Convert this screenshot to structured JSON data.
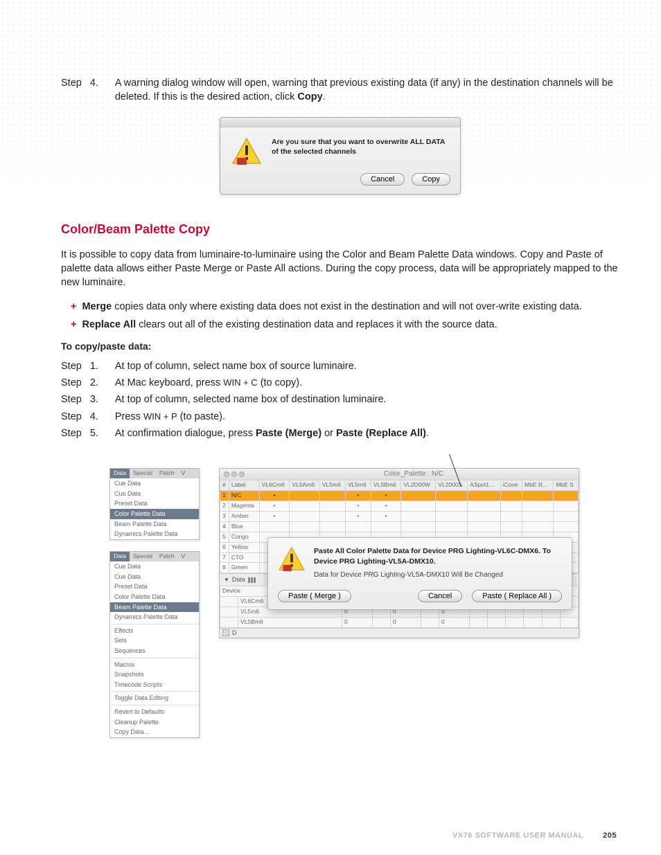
{
  "step4": {
    "label": "Step",
    "num": "4.",
    "text_a": "A warning dialog window will open, warning that previous existing data (if any) in the destination channels will be deleted. If this is the desired action, click ",
    "text_b": "Copy",
    "text_c": "."
  },
  "dialog1": {
    "message": "Are you sure that you want to overwrite ALL DATA of the selected channels",
    "cancel": "Cancel",
    "copy": "Copy"
  },
  "section_title": "Color/Beam Palette Copy",
  "intro": "It is possible to copy data from luminaire-to-luminaire using the Color and Beam Palette Data windows. Copy and Paste of palette data allows either Paste Merge or Paste All actions. During the copy process, data will be appropriately mapped to the new luminaire.",
  "bullets": [
    {
      "bold": "Merge",
      "rest": " copies data only where existing data does not exist in the destination and will not over-write existing data."
    },
    {
      "bold": "Replace All",
      "rest": " clears out all of the existing destination data and replaces it with the source data."
    }
  ],
  "subheading": "To copy/paste data:",
  "steps": [
    {
      "label": "Step",
      "num": "1.",
      "body": "At top of column, select name box of source luminaire."
    },
    {
      "label": "Step",
      "num": "2.",
      "body_a": "At Mac keyboard, press ",
      "kbd": "WIN + C",
      "body_b": " (to copy)."
    },
    {
      "label": "Step",
      "num": "3.",
      "body": "At top of column, selected name box of destination luminaire."
    },
    {
      "label": "Step",
      "num": "4.",
      "body_a": "Press ",
      "kbd": "WIN + P",
      "body_b": " (to paste)."
    },
    {
      "label": "Step",
      "num": "5.",
      "body_a": "At confirmation dialogue, press ",
      "bold1": "Paste (Merge)",
      "mid": " or ",
      "bold2": "Paste (Replace All)",
      "end": "."
    }
  ],
  "menu": {
    "tabs": [
      "Data",
      "Special",
      "Patch",
      "V"
    ],
    "panel1": {
      "items": [
        "Cue Data",
        "Cue Data",
        "Preset Data",
        "Color Palette Data",
        "Beam Palette Data",
        "Dynamics Palette Data"
      ],
      "selected": 3
    },
    "panel2": {
      "items": [
        "Cue Data",
        "Cue Data",
        "Preset Data",
        "Color Palette Data",
        "Beam Palette Data",
        "Dynamics Palette Data"
      ],
      "selected": 4,
      "groups": [
        [
          "Effects",
          "Sets",
          "Sequences"
        ],
        [
          "Macros",
          "Snapshots",
          "Timecode Scripts"
        ],
        [
          "Toggle Data Editing"
        ],
        [
          "Revert to Defaults",
          "Cleanup Palette",
          "Copy Data…"
        ]
      ]
    }
  },
  "palette": {
    "title": "Color_Palette : N/C",
    "columns": [
      "#",
      "Label",
      "VL6Cm6",
      "VL5Am6",
      "VL5m6",
      "VL5m6",
      "VL5Bm6",
      "VL2D00W",
      "VL2000S",
      "ASpot1…",
      "iCove",
      "MbE R…",
      "MbE S"
    ],
    "rows": [
      {
        "n": "1",
        "label": "N/C",
        "dots": [
          1,
          0,
          0,
          1,
          1,
          0,
          0,
          0,
          0,
          0,
          0
        ],
        "sel": true
      },
      {
        "n": "2",
        "label": "Magenta",
        "dots": [
          1,
          0,
          0,
          1,
          1,
          0,
          0,
          0,
          0,
          0,
          0
        ]
      },
      {
        "n": "3",
        "label": "Amber",
        "dots": [
          1,
          0,
          0,
          1,
          1,
          0,
          0,
          0,
          0,
          0,
          0
        ]
      },
      {
        "n": "4",
        "label": "Blue",
        "dots": [
          0,
          0,
          0,
          0,
          0,
          0,
          0,
          0,
          0,
          0,
          0
        ]
      },
      {
        "n": "5",
        "label": "Congo",
        "dots": [
          0,
          0,
          0,
          0,
          0,
          0,
          0,
          0,
          0,
          0,
          0
        ]
      },
      {
        "n": "6",
        "label": "Yellow",
        "dots": [
          0,
          0,
          0,
          0,
          0,
          0,
          0,
          0,
          0,
          0,
          0
        ]
      },
      {
        "n": "7",
        "label": "CTO",
        "dots": [
          0,
          0,
          0,
          0,
          0,
          0,
          0,
          0,
          0,
          0,
          0
        ]
      },
      {
        "n": "8",
        "label": "Green",
        "dots": [
          0,
          0,
          0,
          0,
          0,
          0,
          0,
          0,
          0,
          0,
          0
        ]
      }
    ],
    "data_section_label": "Data",
    "device_header": "Device",
    "devices": [
      {
        "name": "VL6Cm6",
        "vals": [
          "",
          "",
          "",
          "",
          "",
          "",
          "",
          "",
          "",
          "",
          ""
        ]
      },
      {
        "name": "VL5m6",
        "vals": [
          "0",
          "",
          "0",
          "",
          "0",
          "",
          "",
          "",
          "",
          "",
          ""
        ]
      },
      {
        "name": "VL5Bm6",
        "vals": [
          "0",
          "",
          "0",
          "",
          "0",
          "",
          "",
          "",
          "",
          "",
          ""
        ]
      }
    ],
    "status_D": "D"
  },
  "paste_dialog": {
    "bold": "Paste All Color Palette Data for Device PRG Lighting-VL6C-DMX6.  To Device PRG Lighting-VL5A-DMX10.",
    "plain": "Data for Device PRG Lighting-VL5A-DMX10 Will Be Changed",
    "merge": "Paste ( Merge )",
    "cancel": "Cancel",
    "replace": "Paste ( Replace All )"
  },
  "footer": {
    "manual": "VX76 SOFTWARE USER MANUAL",
    "page": "205"
  }
}
